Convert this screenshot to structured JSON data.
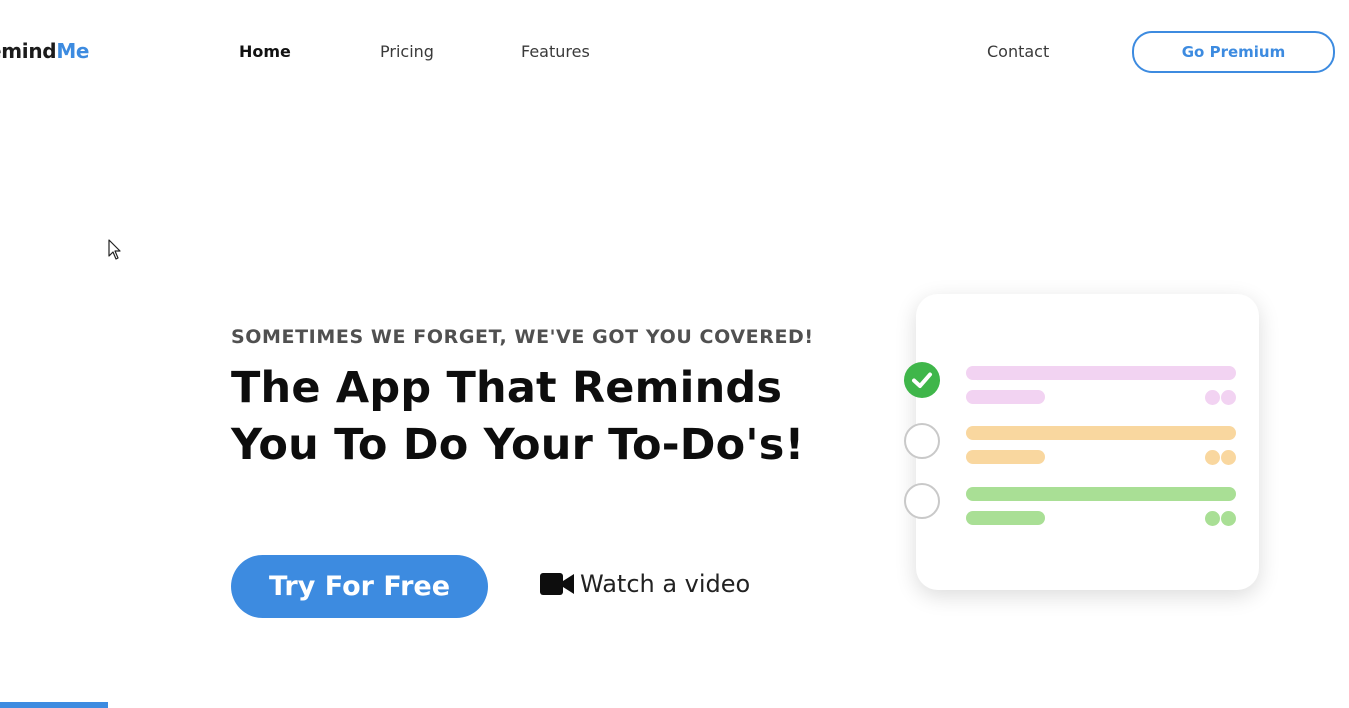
{
  "nav": {
    "logo_part1": "emind",
    "logo_part2": "Me",
    "links": [
      "Home",
      "Pricing",
      "Features"
    ],
    "contact": "Contact",
    "premium_label": "Go Premium"
  },
  "hero": {
    "eyebrow": "SOMETIMES WE FORGET, WE'VE GOT YOU COVERED!",
    "headline_line1": "The App That Reminds",
    "headline_line2": "You To Do Your To-Do's!",
    "cta_label": "Try For Free",
    "watch_label": "Watch a video"
  },
  "icons": {
    "video": "video-camera-icon",
    "check": "check-icon",
    "cursor": "mouse-cursor-icon"
  },
  "colors": {
    "accent": "#3d8be0",
    "check_green": "#3fb64a",
    "row1": "#f2d3f2",
    "row2": "#f9d79f",
    "row3": "#a9df95"
  },
  "todo_card": {
    "items": [
      {
        "state": "done"
      },
      {
        "state": "open"
      },
      {
        "state": "open"
      }
    ]
  }
}
